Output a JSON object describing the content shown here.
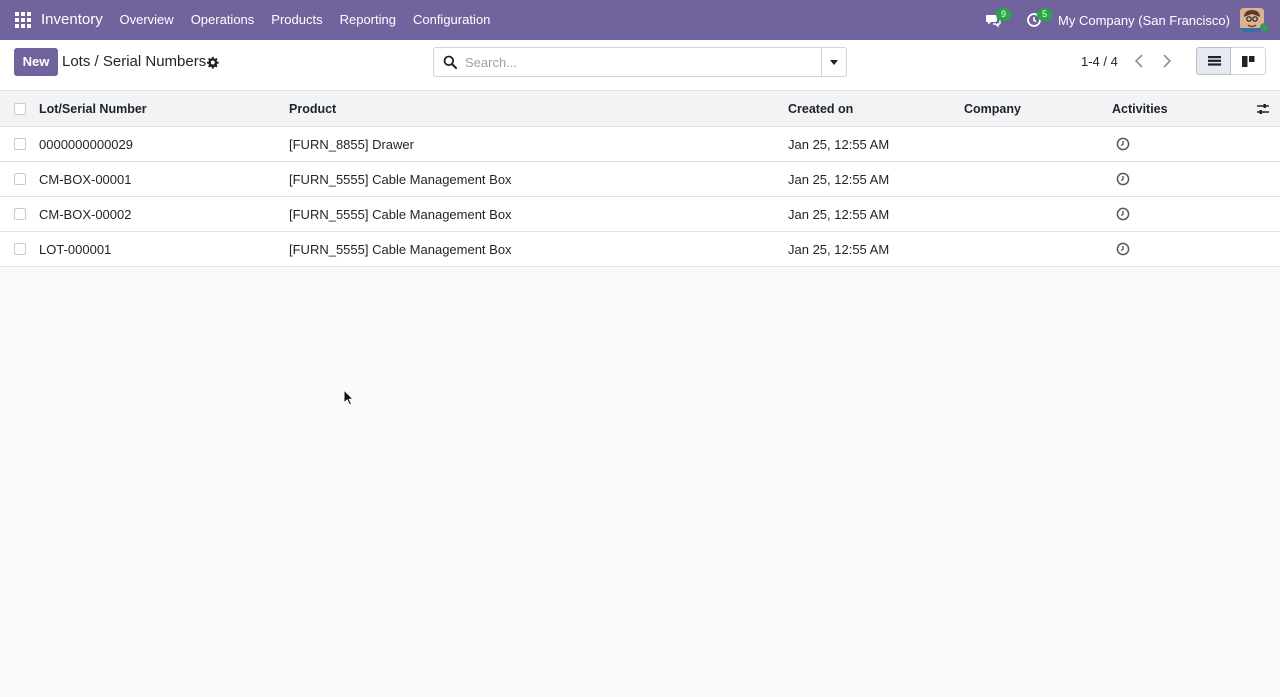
{
  "navbar": {
    "app_name": "Inventory",
    "menu": [
      "Overview",
      "Operations",
      "Products",
      "Reporting",
      "Configuration"
    ],
    "messages_count": "9",
    "activities_count": "5",
    "company": "My Company (San Francisco)",
    "accent_color": "#71639e"
  },
  "control": {
    "new_label": "New",
    "breadcrumb": "Lots / Serial Numbers",
    "search_placeholder": "Search...",
    "pager": "1-4 / 4"
  },
  "table": {
    "columns": [
      "Lot/Serial Number",
      "Product",
      "Created on",
      "Company",
      "Activities"
    ],
    "rows": [
      {
        "lot": "0000000000029",
        "product": "[FURN_8855] Drawer",
        "created": "Jan 25, 12:55 AM",
        "company": ""
      },
      {
        "lot": "CM-BOX-00001",
        "product": "[FURN_5555] Cable Management Box",
        "created": "Jan 25, 12:55 AM",
        "company": ""
      },
      {
        "lot": "CM-BOX-00002",
        "product": "[FURN_5555] Cable Management Box",
        "created": "Jan 25, 12:55 AM",
        "company": ""
      },
      {
        "lot": "LOT-000001",
        "product": "[FURN_5555] Cable Management Box",
        "created": "Jan 25, 12:55 AM",
        "company": ""
      }
    ]
  },
  "icons": {
    "apps": "apps-grid-icon",
    "messages": "chat-icon",
    "activities": "clock-icon",
    "settings": "gear-icon",
    "search": "search-icon",
    "list_view": "list-view-icon",
    "kanban_view": "kanban-view-icon",
    "optional_columns": "sliders-icon"
  }
}
